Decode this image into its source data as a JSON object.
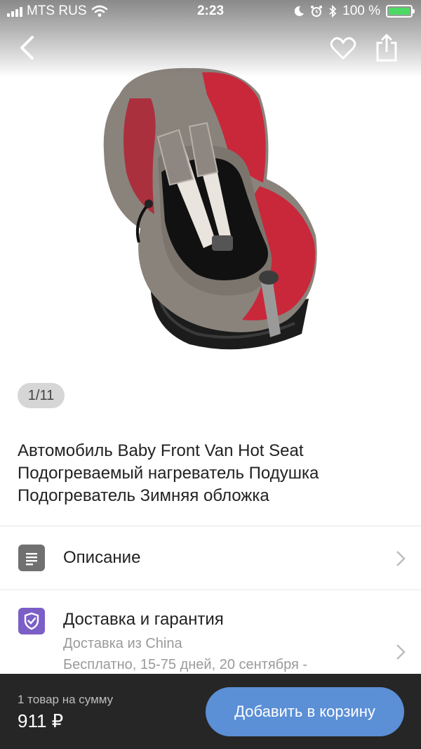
{
  "status_bar": {
    "carrier": "MTS RUS",
    "time": "2:23",
    "battery_percent": "100 %",
    "battery_level": 1.0
  },
  "nav": {
    "back_icon": "chevron-left-icon",
    "favorite_icon": "heart-outline-icon",
    "share_icon": "share-icon"
  },
  "gallery": {
    "counter": "1/11",
    "current": 1,
    "total": 11
  },
  "product": {
    "title": "Автомобиль Baby Front Van Hot Seat Подогреваемый нагреватель Подушка Подогреватель Зимняя обложка"
  },
  "sections": {
    "description": {
      "label": "Описание",
      "icon": "document-icon"
    },
    "delivery": {
      "label": "Доставка и гарантия",
      "icon": "shield-check-icon",
      "line1": "Доставка из China",
      "line2": "Бесплатно, 15-75 дней, 20 сентября -"
    }
  },
  "bottom_bar": {
    "sum_label": "1 товар на сумму",
    "price": "911 ₽",
    "add_to_cart": "Добавить в корзину"
  },
  "colors": {
    "accent_button": "#5b8fd6",
    "bottom_bar": "#262626",
    "delivery_icon": "#7b5fc7",
    "description_icon": "#707070"
  }
}
